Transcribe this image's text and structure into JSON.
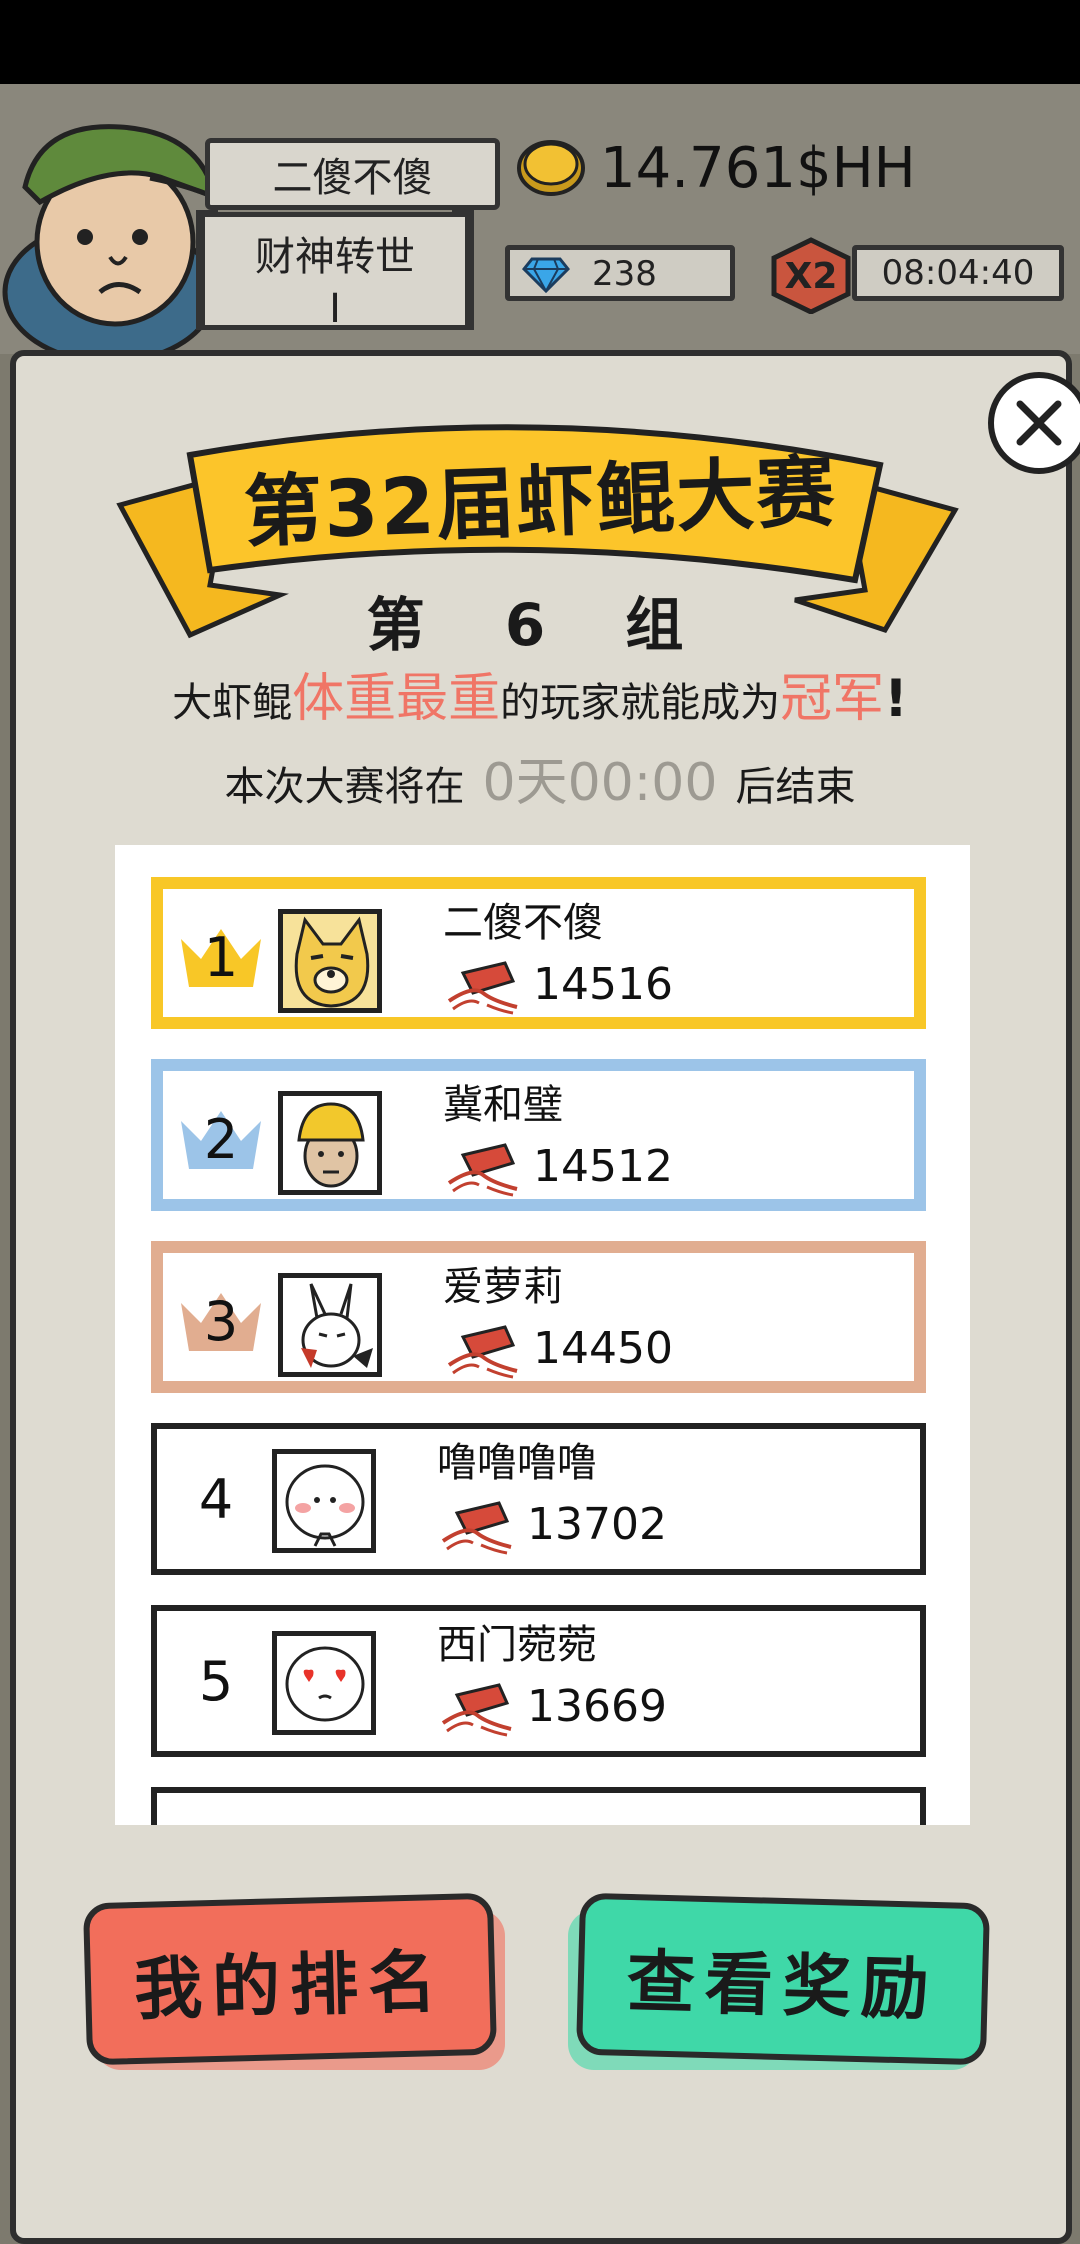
{
  "player": {
    "name": "二傻不傻",
    "title": "财神转世",
    "title_level": "Ⅰ"
  },
  "currency": {
    "coins": "14.761$HH",
    "gems": "238",
    "multiplier": "X2",
    "timer": "08:04:40"
  },
  "contest": {
    "title": "第32届虾鲲大赛",
    "group": "第 6 组",
    "rule_prefix": "大虾鲲",
    "rule_highlight": "体重最重",
    "rule_middle": "的玩家就能成为",
    "rule_champion": "冠军",
    "rule_suffix": "!",
    "end_prefix": "本次大赛将在",
    "end_time": "0天00:00",
    "end_suffix": "后结束"
  },
  "leaderboard": [
    {
      "rank": "1",
      "name": "二傻不傻",
      "weight": "14516",
      "tier": "gold"
    },
    {
      "rank": "2",
      "name": "冀和璧",
      "weight": "14512",
      "tier": "silver"
    },
    {
      "rank": "3",
      "name": "爱萝莉",
      "weight": "14450",
      "tier": "bronze"
    },
    {
      "rank": "4",
      "name": "噜噜噜噜",
      "weight": "13702",
      "tier": "normal"
    },
    {
      "rank": "5",
      "name": "西门菀菀",
      "weight": "13669",
      "tier": "normal"
    }
  ],
  "buttons": {
    "my_rank": "我的排名",
    "view_reward": "查看奖励"
  },
  "colors": {
    "gold": "#f8c727",
    "silver": "#9cc4e8",
    "bronze": "#e1ad90",
    "highlight": "#f07566",
    "btn_red": "#f26e5b",
    "btn_green": "#3fd8a8"
  }
}
